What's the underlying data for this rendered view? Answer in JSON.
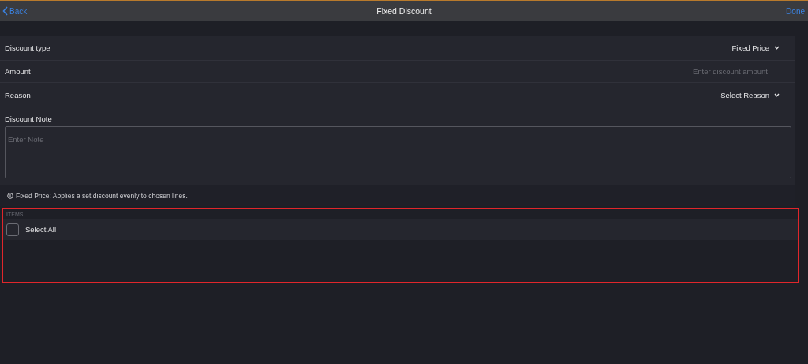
{
  "navbar": {
    "back": "Back",
    "title": "Fixed Discount",
    "done": "Done"
  },
  "fields": [
    {
      "kind": "dropdown",
      "label": "Discount type",
      "value": "Fixed Price"
    },
    {
      "kind": "input",
      "label": "Amount",
      "placeholder": "Enter discount amount"
    },
    {
      "kind": "dropdown",
      "label": "Reason",
      "value": "Select Reason"
    }
  ],
  "note": {
    "label": "Discount Note",
    "placeholder": "Enter Note"
  },
  "info": "Fixed Price: Applies a set discount evenly to chosen lines.",
  "items": {
    "header": "ITEMS",
    "highlighted": true,
    "select_all": {
      "label": "Select All",
      "checked": false
    }
  }
}
